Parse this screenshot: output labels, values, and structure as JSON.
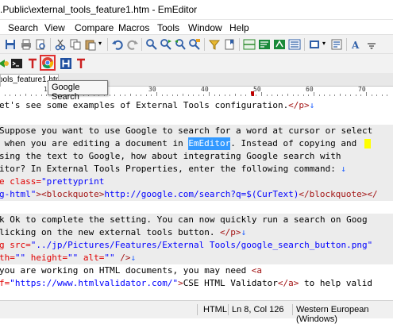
{
  "window": {
    "title": ".Public\\external_tools_feature1.htm - EmEditor"
  },
  "menu": [
    "Search",
    "View",
    "Compare",
    "Macros",
    "Tools",
    "Window",
    "Help"
  ],
  "tab": {
    "label": "ools_feature1.htm"
  },
  "tooltip": {
    "text": "Google Search"
  },
  "ruler": {
    "numbers": [
      "10",
      "20",
      "30",
      "40",
      "50",
      "60",
      "70"
    ]
  },
  "editor": {
    "lines": [
      [
        {
          "c": "t",
          "s": "et's see some examples of External Tools configuration."
        },
        {
          "c": "tag",
          "s": "</p>"
        },
        {
          "c": "ret",
          "s": "↓"
        }
      ],
      [],
      [
        {
          "c": "t",
          "s": "Suppose you want to use Google to search for a word at cursor or select"
        }
      ],
      [
        {
          "c": "t",
          "s": " when you are editing a document in "
        },
        {
          "c": "sel",
          "s": "EmEditor"
        },
        {
          "c": "t",
          "s": ". Instead of copying and "
        }
      ],
      [
        {
          "c": "t",
          "s": "sing the text to Google, how about integrating Google search with"
        }
      ],
      [
        {
          "c": "t",
          "s": "itor? In External Tools Properties, enter the following command: "
        },
        {
          "c": "ret",
          "s": "↓"
        }
      ],
      [
        {
          "c": "attr",
          "s": "e class="
        },
        {
          "c": "val",
          "s": "\"prettyprint"
        }
      ],
      [
        {
          "c": "val",
          "s": "g-html\""
        },
        {
          "c": "tag",
          "s": "><blockquote>"
        },
        {
          "c": "val",
          "s": "http://google.com/search?q=$(CurText)"
        },
        {
          "c": "tag",
          "s": "</blockquote></"
        }
      ],
      [],
      [
        {
          "c": "t",
          "s": "k Ok to complete the setting. You can now quickly run a search on Goog"
        }
      ],
      [
        {
          "c": "t",
          "s": "licking on the new external tools button. "
        },
        {
          "c": "tag",
          "s": "</p>"
        },
        {
          "c": "ret",
          "s": "↓"
        }
      ],
      [
        {
          "c": "attr",
          "s": "g src="
        },
        {
          "c": "val",
          "s": "\"../jp/Pictures/Features/External Tools/google_search_button.png\""
        }
      ],
      [
        {
          "c": "attr",
          "s": "th="
        },
        {
          "c": "val",
          "s": "\"\""
        },
        {
          "c": "attr",
          "s": " height="
        },
        {
          "c": "val",
          "s": "\"\""
        },
        {
          "c": "attr",
          "s": " alt="
        },
        {
          "c": "val",
          "s": "\"\""
        },
        {
          "c": "tag",
          "s": " />"
        },
        {
          "c": "ret",
          "s": "↓"
        }
      ],
      [
        {
          "c": "t",
          "s": "you are working on HTML documents, you may need "
        },
        {
          "c": "tag",
          "s": "<a"
        }
      ],
      [
        {
          "c": "attr",
          "s": "f="
        },
        {
          "c": "val",
          "s": "\"https://www.htmlvalidator.com/\""
        },
        {
          "c": "tag",
          "s": ">"
        },
        {
          "c": "t",
          "s": "CSE HTML Validator"
        },
        {
          "c": "tag",
          "s": "</a>"
        },
        {
          "c": "t",
          "s": " to help valid"
        }
      ]
    ]
  },
  "status": {
    "mode": "HTML",
    "position": "Ln 8, Col 126",
    "encoding": "Western European (Windows)"
  }
}
